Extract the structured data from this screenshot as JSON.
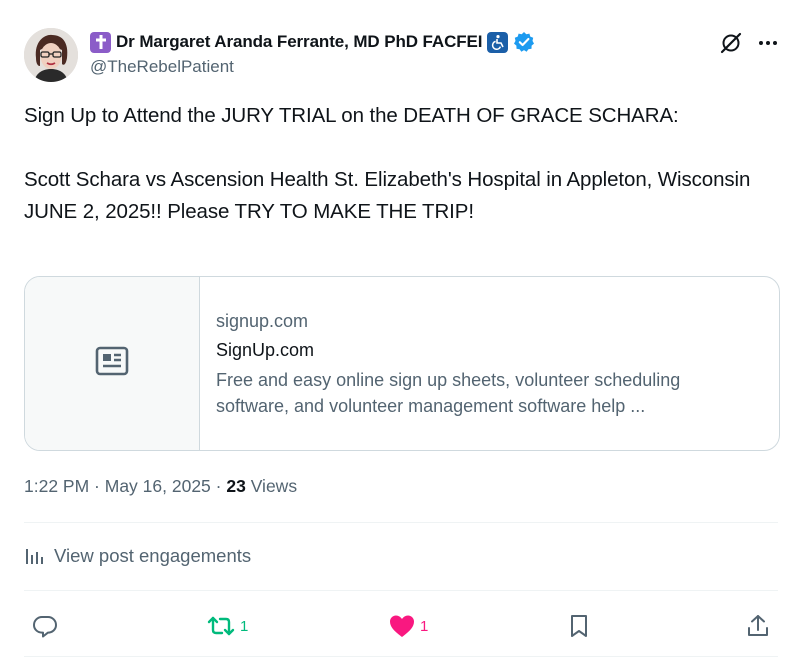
{
  "author": {
    "name": "Dr Margaret Aranda Ferrante, MD PhD FACFEI",
    "handle": "@TheRebelPatient"
  },
  "post": {
    "text": "Sign Up to Attend the JURY TRIAL on the DEATH OF GRACE SCHARA:\n\nScott Schara vs Ascension Health St. Elizabeth's Hospital in Appleton, Wisconsin\nJUNE 2, 2025!! Please TRY TO MAKE THE TRIP!"
  },
  "link_card": {
    "domain": "signup.com",
    "title": "SignUp.com",
    "description": "Free and easy online sign up sheets, volunteer scheduling software, and volunteer management software help ..."
  },
  "meta": {
    "time": "1:22 PM",
    "separator": " · ",
    "date": "May 16, 2025",
    "views_count": "23",
    "views_label": "Views"
  },
  "engagements_label": "View post engagements",
  "actions": {
    "reposts": "1",
    "likes": "1"
  },
  "colors": {
    "verified": "#1d9bf0",
    "repost": "#00ba7c",
    "like": "#f91880",
    "cross_badge": "#8b5cc8",
    "accessibility_badge": "#1b5fa8"
  },
  "icons": [
    "cross-badge-icon",
    "accessibility-badge-icon",
    "verified-icon",
    "grok-icon",
    "more-icon",
    "newspaper-icon",
    "analytics-icon",
    "reply-icon",
    "repost-icon",
    "like-icon",
    "bookmark-icon",
    "share-icon"
  ]
}
